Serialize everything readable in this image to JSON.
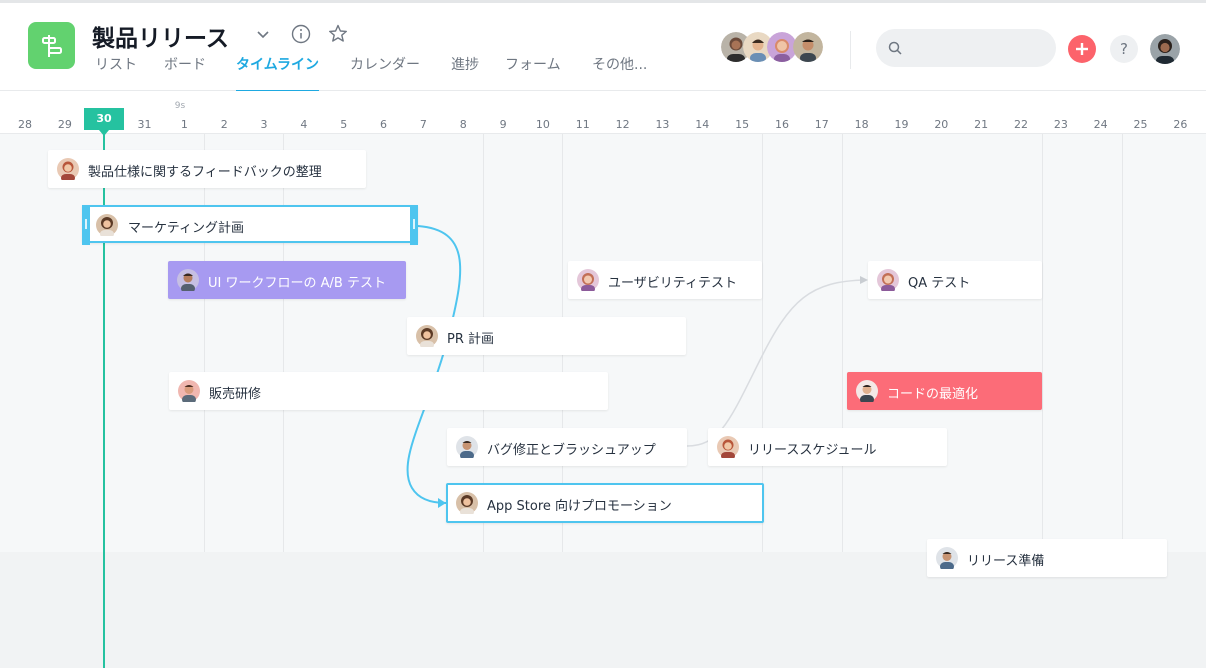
{
  "project": {
    "title": "製品リリース",
    "tabs": [
      {
        "label": "リスト",
        "active": false
      },
      {
        "label": "ボード",
        "active": false
      },
      {
        "label": "タイムライン",
        "active": true
      },
      {
        "label": "カレンダー",
        "active": false
      },
      {
        "label": "進捗",
        "active": false
      },
      {
        "label": "フォーム",
        "active": false
      },
      {
        "label": "その他...",
        "active": false
      }
    ]
  },
  "header": {
    "search_placeholder": "",
    "help_label": "?"
  },
  "colors": {
    "accent": "#1ea9e1",
    "today": "#25c2a0",
    "app_icon": "#62d26f",
    "purple_task": "#a79af1",
    "red_task": "#fc6c78",
    "add_button": "#fc636b"
  },
  "timeline": {
    "month_label": "9s",
    "today": "30",
    "dates": [
      "28",
      "29",
      "30",
      "31",
      "1",
      "2",
      "3",
      "4",
      "5",
      "6",
      "7",
      "8",
      "9",
      "10",
      "11",
      "12",
      "13",
      "14",
      "15",
      "16",
      "17",
      "18",
      "19",
      "20",
      "21",
      "22",
      "23",
      "24",
      "25",
      "26"
    ]
  },
  "tasks": [
    {
      "id": "t1",
      "label": "製品仕様に関するフィードバックの整理"
    },
    {
      "id": "t2",
      "label": "マーケティング計画"
    },
    {
      "id": "t3",
      "label": "UI ワークフローの A/B テスト"
    },
    {
      "id": "t4",
      "label": "ユーザビリティテスト"
    },
    {
      "id": "t5",
      "label": "QA テスト"
    },
    {
      "id": "t6",
      "label": "PR 計画"
    },
    {
      "id": "t7",
      "label": "販売研修"
    },
    {
      "id": "t8",
      "label": "コードの最適化"
    },
    {
      "id": "t9",
      "label": "バグ修正とブラッシュアップ"
    },
    {
      "id": "t10",
      "label": "リリーススケジュール"
    },
    {
      "id": "t11",
      "label": "App Store 向けプロモーション"
    },
    {
      "id": "t12",
      "label": "リリース準備"
    }
  ]
}
